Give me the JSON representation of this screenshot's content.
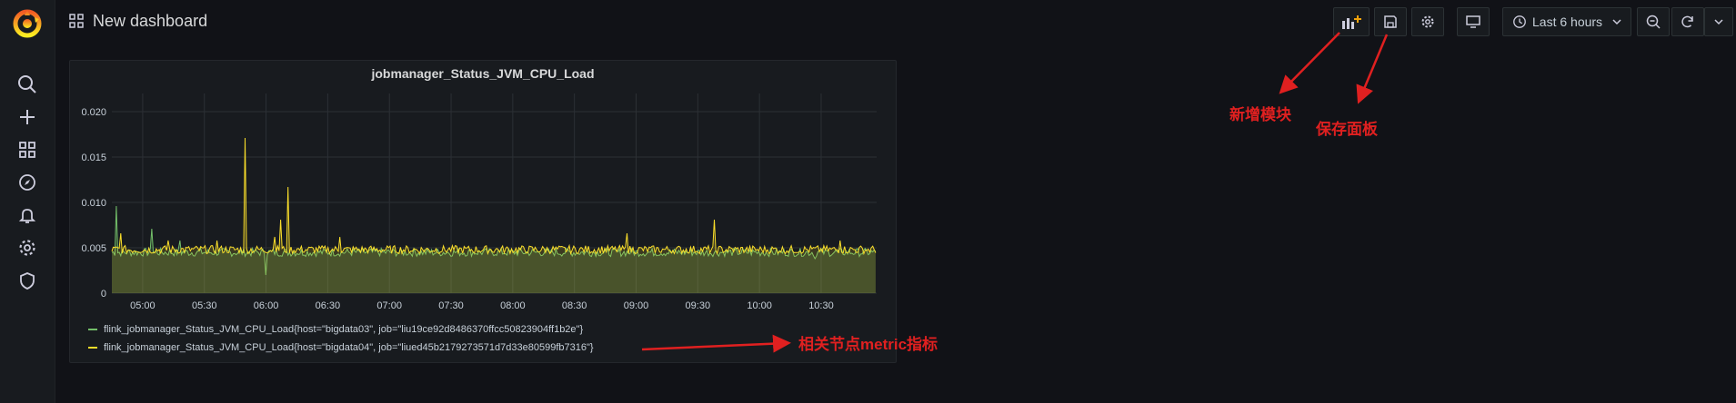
{
  "app": {
    "logo_icon": "grafana-logo",
    "accent": "#f46800"
  },
  "sidebar": {
    "items": [
      {
        "icon": "search-icon",
        "label": ""
      },
      {
        "icon": "plus-icon",
        "label": ""
      },
      {
        "icon": "dashboards-icon",
        "label": ""
      },
      {
        "icon": "compass-icon",
        "label": ""
      },
      {
        "icon": "bell-icon",
        "label": ""
      },
      {
        "icon": "gear-icon",
        "label": ""
      },
      {
        "icon": "shield-icon",
        "label": ""
      }
    ]
  },
  "header": {
    "title": "New dashboard",
    "time_range": "Last 6 hours"
  },
  "panel": {
    "title": "jobmanager_Status_JVM_CPU_Load",
    "legend": [
      {
        "label": "flink_jobmanager_Status_JVM_CPU_Load{host=\"bigdata03\", job=\"liu19ce92d8486370ffcc50823904ff1b2e\"}",
        "color": "#73bf69"
      },
      {
        "label": "flink_jobmanager_Status_JVM_CPU_Load{host=\"bigdata04\", job=\"liued45b2179273571d7d33e80599fb7316\"}",
        "color": "#fade2a"
      }
    ]
  },
  "annotations": {
    "add_panel": "新增模块",
    "save": "保存面板",
    "metric": "相关节点metric指标"
  },
  "chart_data": {
    "type": "line",
    "x": [
      "05:00",
      "05:30",
      "06:00",
      "06:30",
      "07:00",
      "07:30",
      "08:00",
      "08:30",
      "09:00",
      "09:30",
      "10:00",
      "10:30"
    ],
    "y_ticks": [
      "0",
      "0.005",
      "0.010",
      "0.015",
      "0.020"
    ],
    "ylim": [
      0,
      0.021
    ],
    "xlim_hours": [
      4.75,
      10.95
    ],
    "grid": true,
    "legend_position": "bottom",
    "series": [
      {
        "name": "flink_jobmanager_Status_JVM_CPU_Load{host=\"bigdata03\", job=\"liu19ce92d8486370ffcc50823904ff1b2e\"}",
        "baseline": 0.0045,
        "spikes": [
          [
            4.78,
            0.0096
          ],
          [
            5.07,
            0.0071
          ],
          [
            5.3,
            0.0058
          ],
          [
            6.0,
            0.002
          ],
          [
            10.45,
            0.0038
          ]
        ]
      },
      {
        "name": "flink_jobmanager_Status_JVM_CPU_Load{host=\"bigdata04\", job=\"liued45b2179273571d7d33e80599fb7316\"}",
        "baseline": 0.0048,
        "spikes": [
          [
            4.82,
            0.0066
          ],
          [
            5.2,
            0.0058
          ],
          [
            5.6,
            0.0058
          ],
          [
            5.83,
            0.0171
          ],
          [
            6.07,
            0.0062
          ],
          [
            6.12,
            0.0081
          ],
          [
            6.18,
            0.0117
          ],
          [
            6.6,
            0.0062
          ],
          [
            8.92,
            0.0066
          ],
          [
            9.63,
            0.0081
          ],
          [
            10.65,
            0.0058
          ]
        ]
      }
    ]
  }
}
